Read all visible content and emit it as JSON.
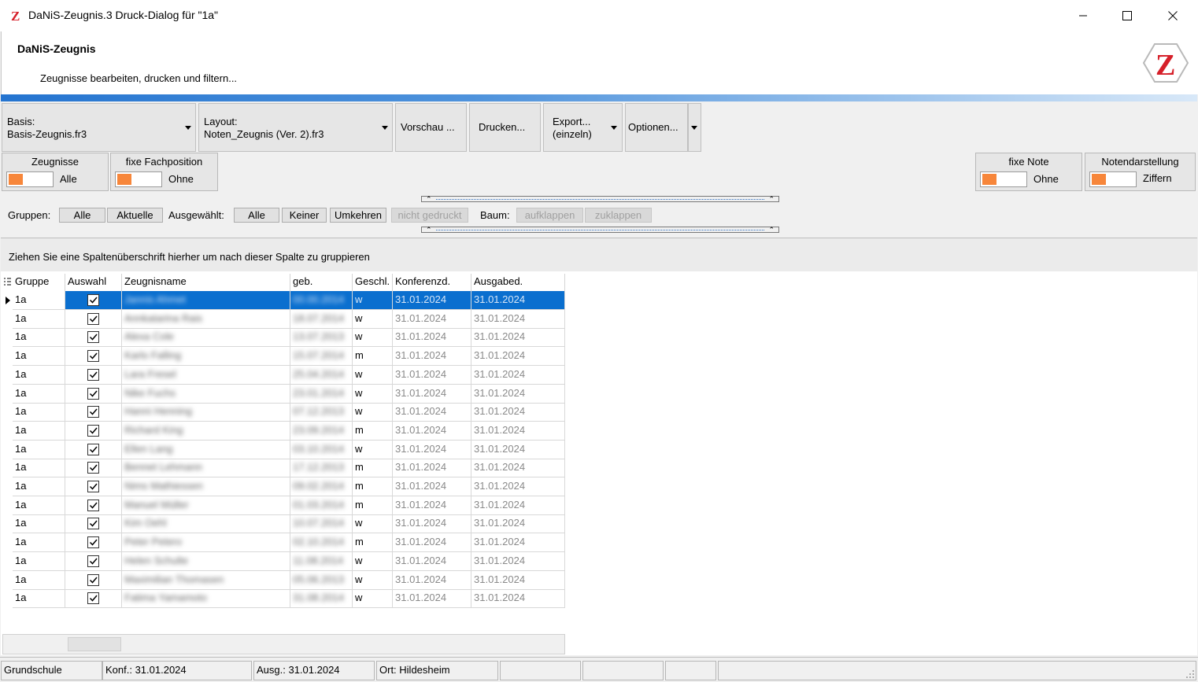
{
  "window": {
    "title": "DaNiS-Zeugnis.3 Druck-Dialog für \"1a\"",
    "app_icon": "z-logo-icon",
    "controls": [
      "minimize-icon",
      "maximize-icon",
      "close-icon"
    ]
  },
  "header": {
    "title": "DaNiS-Zeugnis",
    "subtitle": "Zeugnisse bearbeiten, drucken und  filtern..."
  },
  "toolbar": {
    "basis_label": "Basis:",
    "basis_value": "Basis-Zeugnis.fr3",
    "layout_label": "Layout:",
    "layout_value": "Noten_Zeugnis (Ver. 2).fr3",
    "preview": "Vorschau ...",
    "print": "Drucken...",
    "export_line1": "Export...",
    "export_line2": "(einzeln)",
    "options": "Optionen..."
  },
  "options": {
    "zeugnisse": {
      "title": "Zeugnisse",
      "value": "Alle"
    },
    "fachposition": {
      "title": "fixe Fachposition",
      "value": "Ohne"
    },
    "fixe_note": {
      "title": "fixe Note",
      "value": "Ohne"
    },
    "notendarstellung": {
      "title": "Notendarstellung",
      "value": "Ziffern"
    },
    "accent_color": "#f7863a"
  },
  "filters": {
    "groups_label": "Gruppen:",
    "groups_all": "Alle",
    "groups_current": "Aktuelle",
    "selected_label": "Ausgewählt:",
    "selected_all": "Alle",
    "selected_none": "Keiner",
    "selected_invert": "Umkehren",
    "not_printed": "nicht gedruckt",
    "tree_label": "Baum:",
    "expand": "aufklappen",
    "collapse": "zuklappen"
  },
  "group_panel_text": "Ziehen Sie eine Spaltenüberschrift hierher um nach dieser Spalte zu gruppieren",
  "grid": {
    "columns": [
      "Gruppe",
      "Auswahl",
      "Zeugnisname",
      "geb.",
      "Geschl.",
      "Konferenzd.",
      "Ausgabed."
    ],
    "selection_color": "#0a6fcf",
    "rows": [
      {
        "gruppe": "1a",
        "auswahl": true,
        "name": "Jannis Ahmet",
        "geb": "00.00.2014",
        "geschl": "w",
        "konf": "31.01.2024",
        "ausg": "31.01.2024"
      },
      {
        "gruppe": "1a",
        "auswahl": true,
        "name": "Annkatarina Rais",
        "geb": "18.07.2014",
        "geschl": "w",
        "konf": "31.01.2024",
        "ausg": "31.01.2024"
      },
      {
        "gruppe": "1a",
        "auswahl": true,
        "name": "Alexa Cole",
        "geb": "13.07.2013",
        "geschl": "w",
        "konf": "31.01.2024",
        "ausg": "31.01.2024"
      },
      {
        "gruppe": "1a",
        "auswahl": true,
        "name": "Karlo Falling",
        "geb": "15.07.2014",
        "geschl": "m",
        "konf": "31.01.2024",
        "ausg": "31.01.2024"
      },
      {
        "gruppe": "1a",
        "auswahl": true,
        "name": "Lara Fresel",
        "geb": "25.04.2014",
        "geschl": "w",
        "konf": "31.01.2024",
        "ausg": "31.01.2024"
      },
      {
        "gruppe": "1a",
        "auswahl": true,
        "name": "Nike Fuchs",
        "geb": "23.01.2014",
        "geschl": "w",
        "konf": "31.01.2024",
        "ausg": "31.01.2024"
      },
      {
        "gruppe": "1a",
        "auswahl": true,
        "name": "Hanni Henning",
        "geb": "07.12.2013",
        "geschl": "w",
        "konf": "31.01.2024",
        "ausg": "31.01.2024"
      },
      {
        "gruppe": "1a",
        "auswahl": true,
        "name": "Richard King",
        "geb": "23.09.2014",
        "geschl": "m",
        "konf": "31.01.2024",
        "ausg": "31.01.2024"
      },
      {
        "gruppe": "1a",
        "auswahl": true,
        "name": "Ellen Lang",
        "geb": "03.10.2014",
        "geschl": "w",
        "konf": "31.01.2024",
        "ausg": "31.01.2024"
      },
      {
        "gruppe": "1a",
        "auswahl": true,
        "name": "Bennet Lehmann",
        "geb": "17.12.2013",
        "geschl": "m",
        "konf": "31.01.2024",
        "ausg": "31.01.2024"
      },
      {
        "gruppe": "1a",
        "auswahl": true,
        "name": "Nims Mathiessen",
        "geb": "09.02.2014",
        "geschl": "m",
        "konf": "31.01.2024",
        "ausg": "31.01.2024"
      },
      {
        "gruppe": "1a",
        "auswahl": true,
        "name": "Manuel Müller",
        "geb": "01.03.2014",
        "geschl": "m",
        "konf": "31.01.2024",
        "ausg": "31.01.2024"
      },
      {
        "gruppe": "1a",
        "auswahl": true,
        "name": "Kim Oehl",
        "geb": "10.07.2014",
        "geschl": "w",
        "konf": "31.01.2024",
        "ausg": "31.01.2024"
      },
      {
        "gruppe": "1a",
        "auswahl": true,
        "name": "Peter Petero",
        "geb": "02.10.2014",
        "geschl": "m",
        "konf": "31.01.2024",
        "ausg": "31.01.2024"
      },
      {
        "gruppe": "1a",
        "auswahl": true,
        "name": "Helen Schulte",
        "geb": "11.08.2014",
        "geschl": "w",
        "konf": "31.01.2024",
        "ausg": "31.01.2024"
      },
      {
        "gruppe": "1a",
        "auswahl": true,
        "name": "Maximilian Thomasen",
        "geb": "05.06.2013",
        "geschl": "w",
        "konf": "31.01.2024",
        "ausg": "31.01.2024"
      },
      {
        "gruppe": "1a",
        "auswahl": true,
        "name": "Fatima Yamamoto",
        "geb": "31.08.2014",
        "geschl": "w",
        "konf": "31.01.2024",
        "ausg": "31.01.2024"
      }
    ]
  },
  "statusbar": {
    "school": "Grundschule",
    "konf": "Konf.: 31.01.2024",
    "ausg": "Ausg.: 31.01.2024",
    "ort": "Ort: Hildesheim"
  }
}
